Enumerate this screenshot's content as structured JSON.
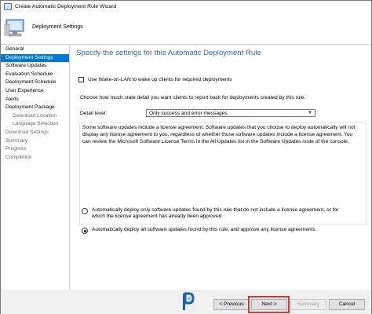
{
  "window": {
    "title": "Create Automatic Deployment Rule Wizard"
  },
  "header": {
    "title": "Deployment Settings"
  },
  "nav": {
    "items": [
      {
        "label": "General",
        "state": "normal"
      },
      {
        "label": "Deployment Settings",
        "state": "active"
      },
      {
        "label": "Software Updates",
        "state": "normal"
      },
      {
        "label": "Evaluation Schedule",
        "state": "normal"
      },
      {
        "label": "Deployment Schedule",
        "state": "normal"
      },
      {
        "label": "User Experience",
        "state": "normal"
      },
      {
        "label": "Alerts",
        "state": "normal"
      },
      {
        "label": "Deployment Package",
        "state": "normal"
      },
      {
        "label": "Download Location",
        "state": "sub"
      },
      {
        "label": "Language Selection",
        "state": "sub"
      },
      {
        "label": "Download Settings",
        "state": "muted"
      },
      {
        "label": "Summary",
        "state": "muted"
      },
      {
        "label": "Progress",
        "state": "muted"
      },
      {
        "label": "Completion",
        "state": "muted"
      }
    ]
  },
  "main": {
    "page_title": "Specify the settings for this Automatic Deployment Rule",
    "wol_checkbox": {
      "label": "Use Wake-on-LAN to wake up clients for required deployments",
      "checked": false
    },
    "detail_description": "Choose how much state detail you want clients to report back for deployments created by this rule.",
    "detail_level": {
      "label": "Detail level:",
      "value": "Only success and error messages"
    },
    "license": {
      "text": "Some software updates include a license agreement. Software updates that you choose to deploy automatically will not display any license agreement to you, regardless of whether those software updates include a license agreement. You can review the Microsoft Software License Terms in the All Updates list in the Software Updates node of the console.",
      "options": [
        {
          "label": "Automatically deploy only software updates found by this rule that do not include a license agreement, or for which the license agreement has already been approved",
          "checked": false
        },
        {
          "label": "Automatically deploy all software updates found by this rule, and approve any license agreements",
          "checked": true
        }
      ]
    }
  },
  "footer": {
    "previous_label": "< Previous",
    "next_label": "Next >",
    "summary_label": "Summary",
    "cancel_label": "Cancel",
    "highlight_color": "#d23b3b",
    "logo_icon": "prajwal-desai-logo-icon"
  },
  "colors": {
    "accent": "#0078d7",
    "title_blue": "#2e6ab1"
  }
}
